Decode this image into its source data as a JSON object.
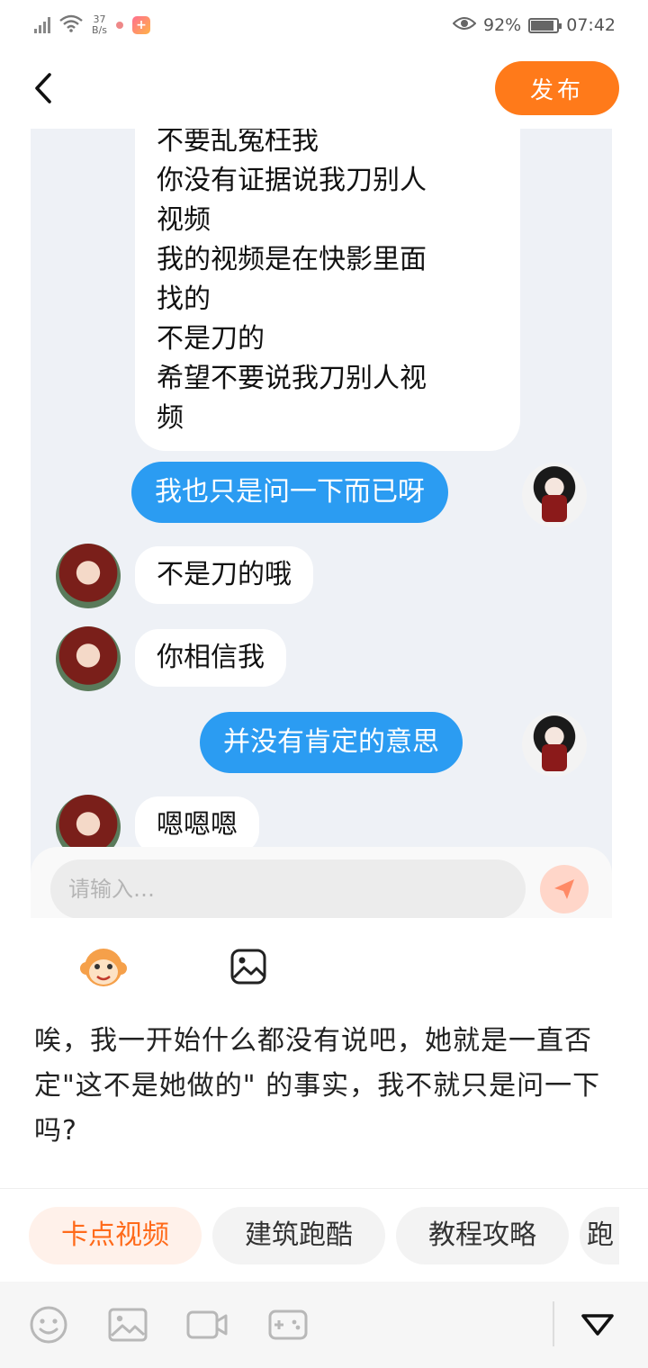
{
  "status_bar": {
    "net_speed_value": "37",
    "net_speed_unit": "B/s",
    "battery": "92%",
    "time": "07:42"
  },
  "header": {
    "back_icon": "chevron-left-icon",
    "publish_label": "发布"
  },
  "chat_screenshot": {
    "first_bubble_lines": [
      "不要乱冤枉我",
      "你没有证据说我刀别人",
      "视频",
      "我的视频是在快影里面",
      "找的",
      "不是刀的",
      "希望不要说我刀别人视",
      "频"
    ],
    "messages": [
      {
        "from": "me",
        "text": "我也只是问一下而已呀"
      },
      {
        "from": "other",
        "text": "不是刀的哦"
      },
      {
        "from": "other",
        "text": "你相信我"
      },
      {
        "from": "me",
        "text": "并没有肯定的意思"
      },
      {
        "from": "other",
        "text": "嗯嗯嗯"
      }
    ],
    "input_placeholder": "请输入…"
  },
  "post_text": "唉，我一开始什么都没有说吧，她就是一直否定\"这不是她做的\" 的事实，我不就只是问一下吗?",
  "tags": [
    "卡点视频",
    "建筑跑酷",
    "教程攻略",
    "跑"
  ],
  "toolbar": {
    "icons": [
      "emoji-icon",
      "image-icon",
      "video-icon",
      "game-icon",
      "collapse-icon"
    ]
  },
  "colors": {
    "accent": "#ff7a1a",
    "chat_blue": "#2b9cf2",
    "chat_bg": "#eef1f6"
  }
}
